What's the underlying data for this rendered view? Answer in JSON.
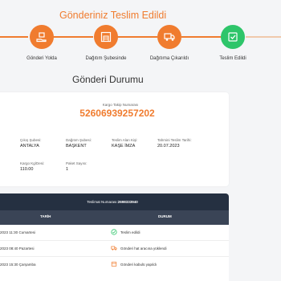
{
  "page_title": "Gönderiniz Teslim Edildi",
  "steps": [
    {
      "label": "Gönderi Yolda",
      "icon": "box-in-hand-icon"
    },
    {
      "label": "Dağıtım Şubesinde",
      "icon": "warehouse-icon"
    },
    {
      "label": "Dağıtıma Çıkarıldı",
      "icon": "delivery-truck-icon"
    },
    {
      "label": "Teslim Edildi",
      "icon": "delivered-package-icon"
    }
  ],
  "section_title": "Gönderi Durumu",
  "tracking": {
    "label": "Kargo Takip Numarası",
    "number": "52606939257202"
  },
  "fields": {
    "origin_branch": {
      "label": "Çıkış Şubesi:",
      "value": "ANTALYA"
    },
    "delivery_branch": {
      "label": "Dağıtım Şubesi:",
      "value": "BAŞKENT"
    },
    "recipient": {
      "label": "Teslim Alan Kişi:",
      "value": "KAŞE İMZA"
    },
    "delivery_date": {
      "label": "Tahmini Teslim Tarihi:",
      "value": "20.07.2023"
    },
    "weight": {
      "label": "Kargo Kg/Desi:",
      "value": "110.00"
    },
    "package_count": {
      "label": "Paket Sayısı:",
      "value": "1"
    }
  },
  "movements": {
    "delivery_label": "Teslimat Numarası:",
    "delivery_number": "2698333940",
    "col_date": "TARİH",
    "col_status": "DURUM",
    "rows": [
      {
        "date": "2023 11:30 Cumartesi",
        "status": "Teslim edildi",
        "icon": "check-circle-icon"
      },
      {
        "date": "2023 08:40 Pazartesi",
        "status": "Gönderi hat aracına yüklendi",
        "icon": "truck-icon"
      },
      {
        "date": "2023 15:30 Çarşamba",
        "status": "Gönderi kabulü yapıldı",
        "icon": "box-icon"
      }
    ]
  },
  "colors": {
    "accent": "#f07c2f",
    "success": "#2ec56a",
    "table_header": "#253041"
  }
}
